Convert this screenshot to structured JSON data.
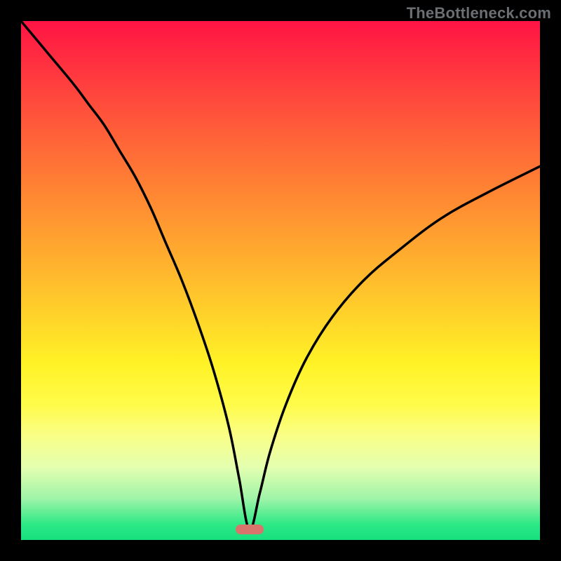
{
  "watermark": "TheBottleneck.com",
  "colors": {
    "frame": "#000000",
    "curve": "#000000",
    "marker": "#d9746d",
    "gradient_top": "#ff1444",
    "gradient_bottom": "#17e07e"
  },
  "chart_data": {
    "type": "line",
    "title": "",
    "xlabel": "",
    "ylabel": "",
    "xlim": [
      0,
      100
    ],
    "ylim": [
      0,
      100
    ],
    "grid": false,
    "legend": false,
    "annotations": [
      "TheBottleneck.com"
    ],
    "marker": {
      "x": 44,
      "y": 2,
      "shape": "pill",
      "color": "#d9746d"
    },
    "series": [
      {
        "name": "bottleneck-curve",
        "x": [
          0,
          5,
          10,
          13,
          16,
          19,
          22,
          25,
          28,
          31,
          34,
          37,
          40,
          42,
          44,
          46,
          48,
          51,
          55,
          60,
          66,
          73,
          81,
          90,
          100
        ],
        "values": [
          100,
          94,
          88,
          84,
          80,
          75,
          70,
          64,
          57,
          50,
          42,
          33,
          22,
          12,
          2,
          9,
          17,
          26,
          35,
          43,
          50,
          56,
          62,
          67,
          72
        ]
      }
    ]
  }
}
